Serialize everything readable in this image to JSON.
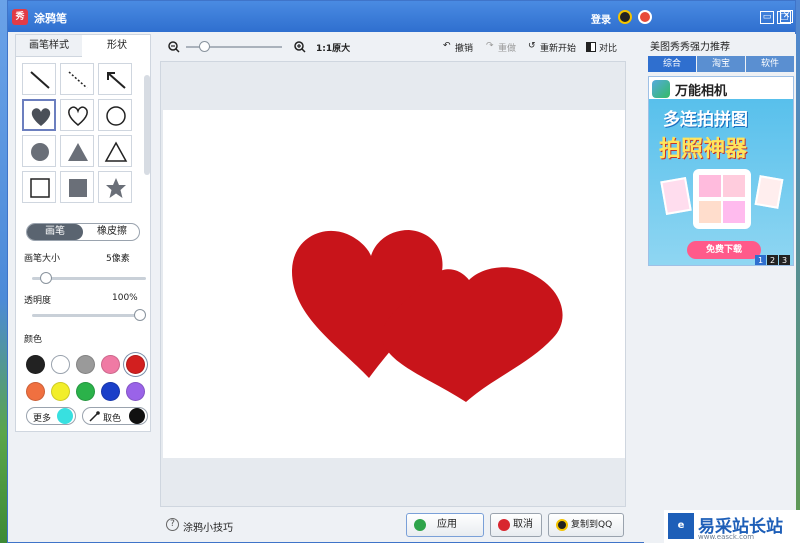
{
  "window": {
    "title": "涂鸦笔",
    "app_icon": "秀",
    "login_label": "登录",
    "controls": {
      "minimize": "▭",
      "maximize": "□",
      "close": "✕"
    }
  },
  "left_panel": {
    "tabs": [
      "画笔样式",
      "形状"
    ],
    "mode_toggle": {
      "on": "画笔",
      "off": "橡皮擦"
    },
    "brush_size": {
      "label": "画笔大小",
      "value_text": "5像素",
      "level": 0.08
    },
    "opacity": {
      "label": "透明度",
      "value_text": "100%",
      "level": 1.0
    },
    "colors_label": "颜色",
    "colors": [
      "#222222",
      "#ffffff",
      "#9a9a9a",
      "#f07aa4",
      "#d21f1f",
      "#f07040",
      "#f2ee2a",
      "#2bb24a",
      "#1a3fc9",
      "#9a63e8"
    ],
    "more_label": "更多",
    "more_color": "#38e0e0",
    "pick_label": "取色",
    "pick_color": "#111111",
    "shapes": [
      "line-icon",
      "dashed-line-icon",
      "arrow-icon",
      "heart-filled-icon",
      "heart-outline-icon",
      "circle-outline-icon",
      "circle-filled-icon",
      "triangle-filled-icon",
      "triangle-outline-icon",
      "square-outline-icon",
      "square-filled-icon",
      "star-filled-icon"
    ],
    "selected_shape": "heart-filled-icon"
  },
  "toolbar": {
    "zoom_level": 0.15,
    "ratio_label": "1:1原大",
    "undo": "撤销",
    "redo": "重做",
    "restart": "重新开始",
    "compare": "对比"
  },
  "canvas": {
    "shape_color": "#c8141a"
  },
  "bottom": {
    "tips": "涂鸦小技巧",
    "apply": "应用",
    "cancel": "取消",
    "copy_qq": "复制到QQ"
  },
  "right_panel": {
    "title": "美图秀秀强力推荐",
    "tabs": [
      "综合",
      "淘宝",
      "软件"
    ],
    "ad": {
      "brand": "万能相机",
      "line1": "多连拍拼图",
      "line2": "拍照神器",
      "button": "免费下载",
      "pages": [
        "1",
        "2",
        "3"
      ]
    }
  },
  "watermark": {
    "site": "易采站长站",
    "url": "www.easck.com"
  }
}
